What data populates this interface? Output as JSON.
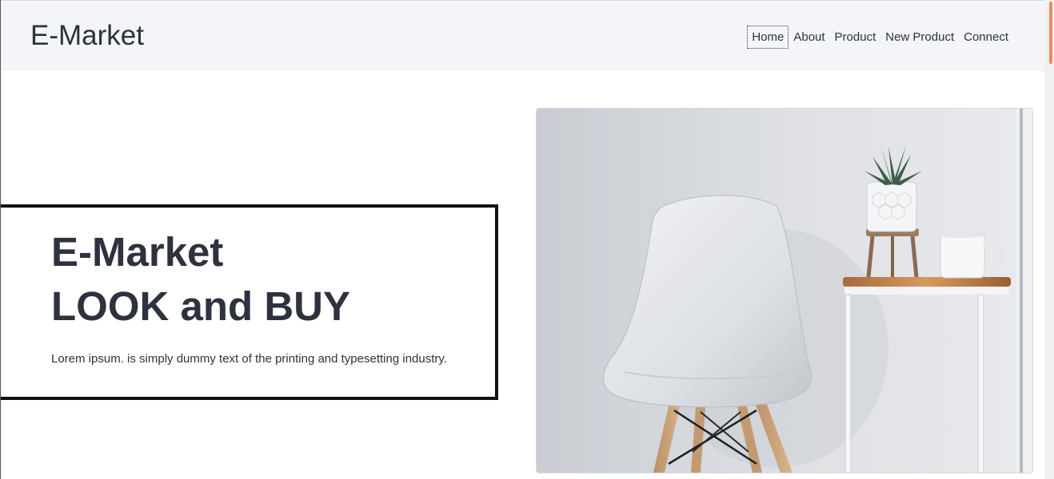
{
  "navbar": {
    "brand": "E-Market",
    "items": [
      {
        "label": "Home",
        "active": true
      },
      {
        "label": "About",
        "active": false
      },
      {
        "label": "Product",
        "active": false
      },
      {
        "label": "New Product",
        "active": false
      },
      {
        "label": "Connect",
        "active": false
      }
    ]
  },
  "hero": {
    "title_line1": "E-Market",
    "title_line2": "LOOK and BUY",
    "description": "Lorem ipsum. is simply dummy text of the printing and typesetting industry.",
    "image_subject": "white-chair-with-plant-and-mug-on-side-table"
  },
  "colors": {
    "text": "#2d323e",
    "navbar_bg": "#f4f5f8",
    "scroll_accent": "#ee8b5d",
    "box_border": "#111111"
  }
}
